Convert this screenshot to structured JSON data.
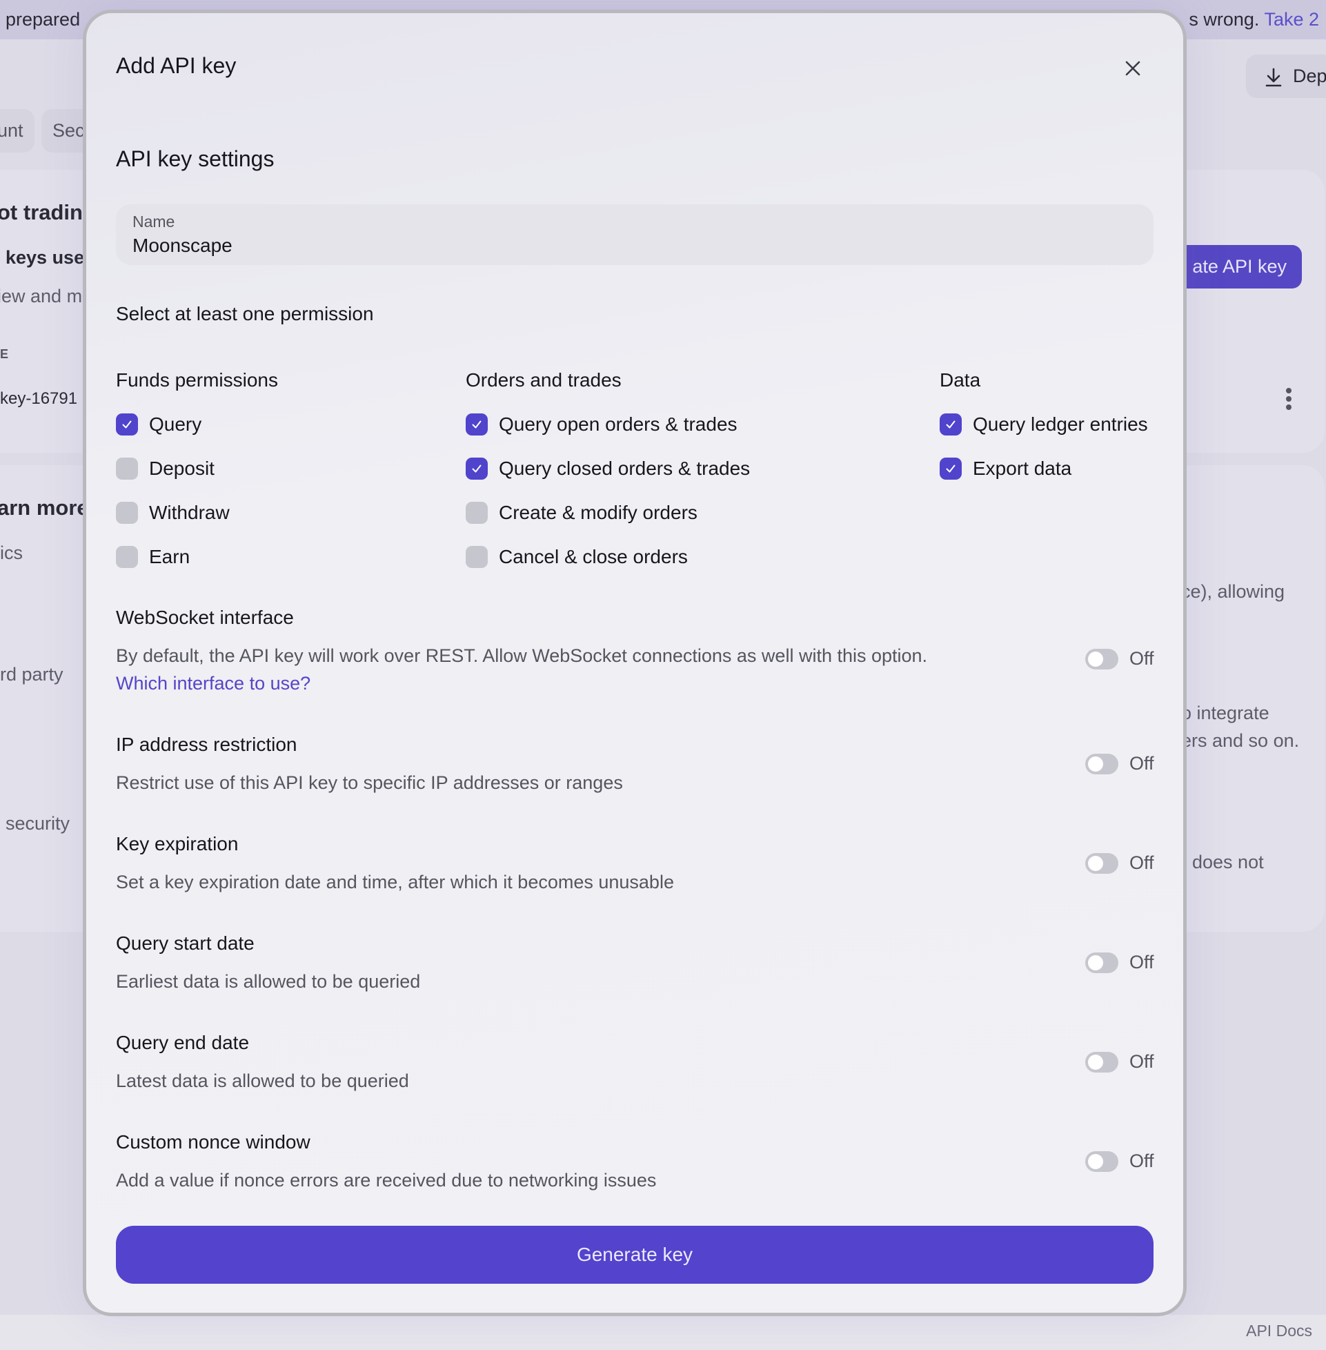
{
  "background": {
    "banner": {
      "left_text": "prepared",
      "right_text": "s wrong.",
      "link_text": "Take 2"
    },
    "deposit_button_label": "Dep",
    "tabs": [
      "unt",
      "Sec"
    ],
    "fragments": {
      "section_heading": "ot trading",
      "keys_heading": "keys use",
      "keys_desc": "iew and m",
      "column_label": "E",
      "key_name": "key-16791",
      "learn_more_heading": "arn more",
      "topic_1": "ics",
      "topic_2": "rd party",
      "topic_3": "security",
      "right_1": "ce), allowing",
      "right_2": "o integrate",
      "right_3": "ers and so on.",
      "right_4": "does not"
    },
    "create_button_label": "ate API key",
    "footer_link": "API Docs"
  },
  "modal": {
    "title": "Add API key",
    "close_icon": "close-icon",
    "section_title": "API key settings",
    "name_field": {
      "label": "Name",
      "value": "Moonscape"
    },
    "permission_hint": "Select at least one permission",
    "permission_groups": [
      {
        "title": "Funds permissions",
        "items": [
          {
            "label": "Query",
            "checked": true
          },
          {
            "label": "Deposit",
            "checked": false
          },
          {
            "label": "Withdraw",
            "checked": false
          },
          {
            "label": "Earn",
            "checked": false
          }
        ]
      },
      {
        "title": "Orders and trades",
        "items": [
          {
            "label": "Query open orders & trades",
            "checked": true
          },
          {
            "label": "Query closed orders & trades",
            "checked": true
          },
          {
            "label": "Create & modify orders",
            "checked": false
          },
          {
            "label": "Cancel & close orders",
            "checked": false
          }
        ]
      },
      {
        "title": "Data",
        "items": [
          {
            "label": "Query ledger entries",
            "checked": true
          },
          {
            "label": "Export data",
            "checked": true
          }
        ]
      }
    ],
    "options": [
      {
        "title": "WebSocket interface",
        "description": "By default, the API key will work over REST. Allow WebSocket connections as well with this option.",
        "link": "Which interface to use?",
        "state": "Off"
      },
      {
        "title": "IP address restriction",
        "description": "Restrict use of this API key to specific IP addresses or ranges",
        "state": "Off"
      },
      {
        "title": "Key expiration",
        "description": "Set a key expiration date and time, after which it becomes unusable",
        "state": "Off"
      },
      {
        "title": "Query start date",
        "description": "Earliest data is allowed to be queried",
        "state": "Off"
      },
      {
        "title": "Query end date",
        "description": "Latest data is allowed to be queried",
        "state": "Off"
      },
      {
        "title": "Custom nonce window",
        "description": "Add a value if nonce errors are received due to networking issues",
        "state": "Off"
      }
    ],
    "generate_button_label": "Generate key"
  },
  "colors": {
    "accent": "#5343cd",
    "link": "#5545c8",
    "checkbox_off": "#c6c6ce",
    "toggle_off": "#c6c6ce"
  }
}
